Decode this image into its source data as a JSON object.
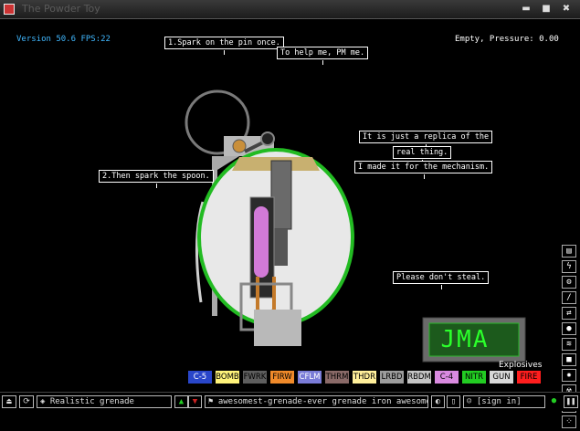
{
  "window": {
    "title": "The Powder Toy",
    "minimize": "▬",
    "maximize": "■",
    "close": "✖"
  },
  "hud": {
    "version": "Version 50.6 FPS:22",
    "status": "Empty, Pressure: 0.00"
  },
  "notes": {
    "n1": "1.Spark on the pin once.",
    "n2": "To help me, PM me.",
    "n3": "It is just a replica of the",
    "n4": "real thing.",
    "n5": "I made it for the mechanism.",
    "n6": "2.Then spark the spoon.",
    "n7": "Please don't steal."
  },
  "logo": "JMA",
  "category_label": "Explosives",
  "elements": [
    {
      "label": "C-5",
      "bg": "#2946c9",
      "fg": "#ffffff"
    },
    {
      "label": "BOMB",
      "bg": "#fff37a",
      "fg": "#000000"
    },
    {
      "label": "FWRK",
      "bg": "#5e5e5e",
      "fg": "#000000"
    },
    {
      "label": "FIRW",
      "bg": "#f08a2a",
      "fg": "#000000"
    },
    {
      "label": "CFLM",
      "bg": "#7a7cd8",
      "fg": "#ffffff"
    },
    {
      "label": "THRM",
      "bg": "#8a6a68",
      "fg": "#000000"
    },
    {
      "label": "THDR",
      "bg": "#ffef9a",
      "fg": "#000000"
    },
    {
      "label": "LRBD",
      "bg": "#9c9c9c",
      "fg": "#000000"
    },
    {
      "label": "RBDM",
      "bg": "#c4c4c4",
      "fg": "#000000"
    },
    {
      "label": "C-4",
      "bg": "#d98ae0",
      "fg": "#000000"
    },
    {
      "label": "NITR",
      "bg": "#22cc22",
      "fg": "#000000"
    },
    {
      "label": "GUN",
      "bg": "#d8d8d8",
      "fg": "#000000"
    },
    {
      "label": "FIRE",
      "bg": "#ff1e1e",
      "fg": "#000000"
    }
  ],
  "menu_icons": [
    "save-icon",
    "electric-icon",
    "powered-icon",
    "sensor-icon",
    "force-icon",
    "liquid-icon",
    "gas-icon",
    "solid-icon",
    "explosives-icon",
    "radioactive-icon",
    "special-icon",
    "life-icon"
  ],
  "bottom": {
    "open": "⏏",
    "reload": "⟳",
    "save_name": "Realistic grenade",
    "vote_up": "▲",
    "vote_down": "▼",
    "tags_icon": "⚑",
    "tags": "awesomest-grenade-ever grenade iron awesome ...",
    "clear": "◐",
    "report": "▯",
    "signin": "[sign in]",
    "pause": "❚❚"
  }
}
